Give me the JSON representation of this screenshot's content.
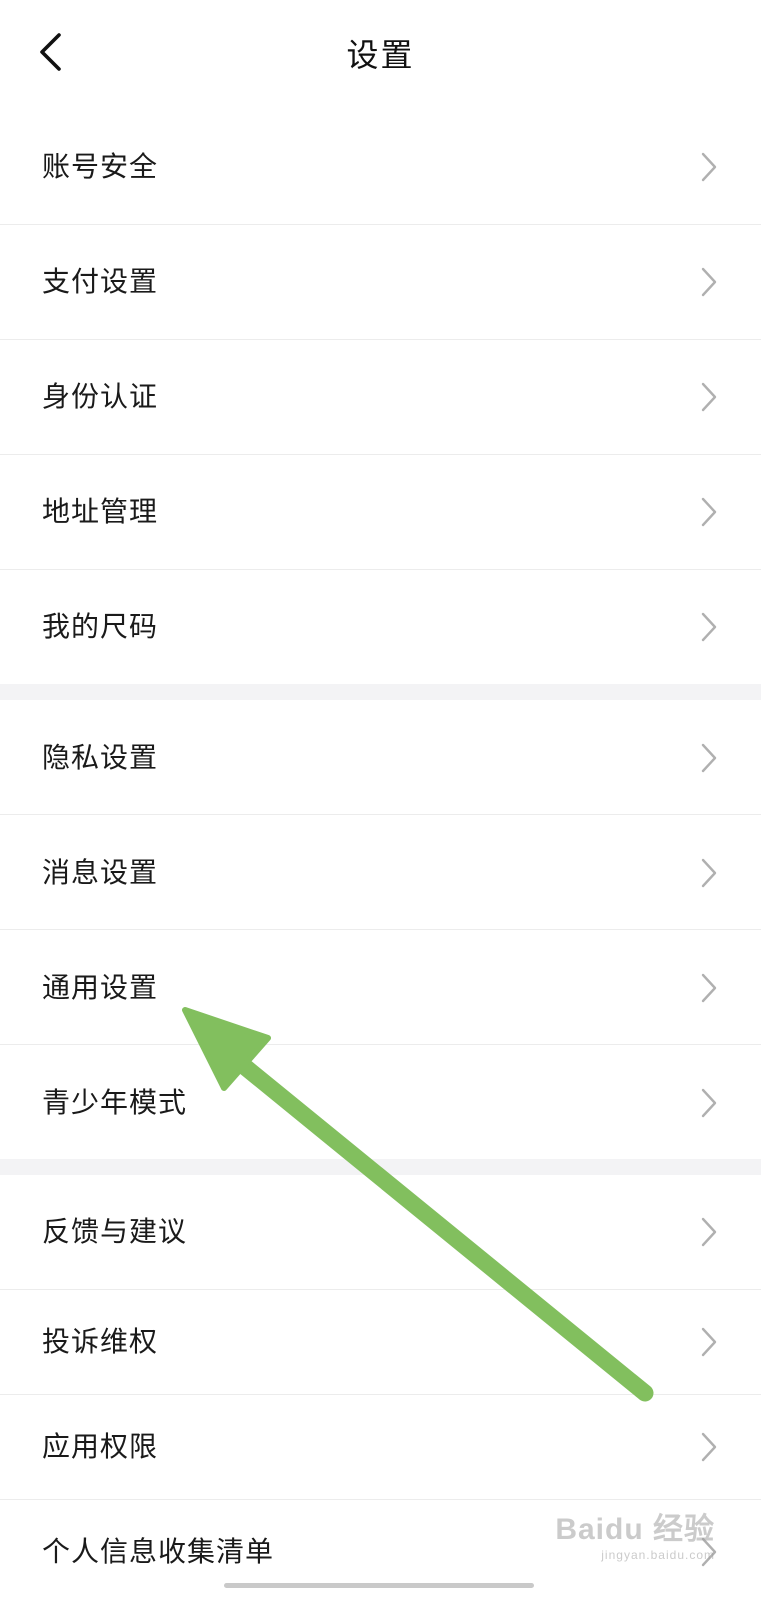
{
  "header": {
    "title": "设置",
    "back_icon": "chevron-left-icon"
  },
  "groups": [
    {
      "items": [
        {
          "label": "账号安全"
        },
        {
          "label": "支付设置"
        },
        {
          "label": "身份认证"
        },
        {
          "label": "地址管理"
        },
        {
          "label": "我的尺码"
        }
      ]
    },
    {
      "items": [
        {
          "label": "隐私设置"
        },
        {
          "label": "消息设置"
        },
        {
          "label": "通用设置"
        },
        {
          "label": "青少年模式"
        }
      ]
    },
    {
      "items": [
        {
          "label": "反馈与建议"
        },
        {
          "label": "投诉维权"
        },
        {
          "label": "应用权限"
        },
        {
          "label": "个人信息收集清单"
        }
      ]
    }
  ],
  "annotation": {
    "arrow_color": "#82bf5e",
    "points_to": "通用设置"
  },
  "watermark": {
    "brand": "Baidu 经验",
    "url": "jingyan.baidu.com"
  },
  "colors": {
    "background": "#ffffff",
    "group_gap": "#f3f3f5",
    "divider": "#ececec",
    "chevron": "#b0b0b0"
  }
}
